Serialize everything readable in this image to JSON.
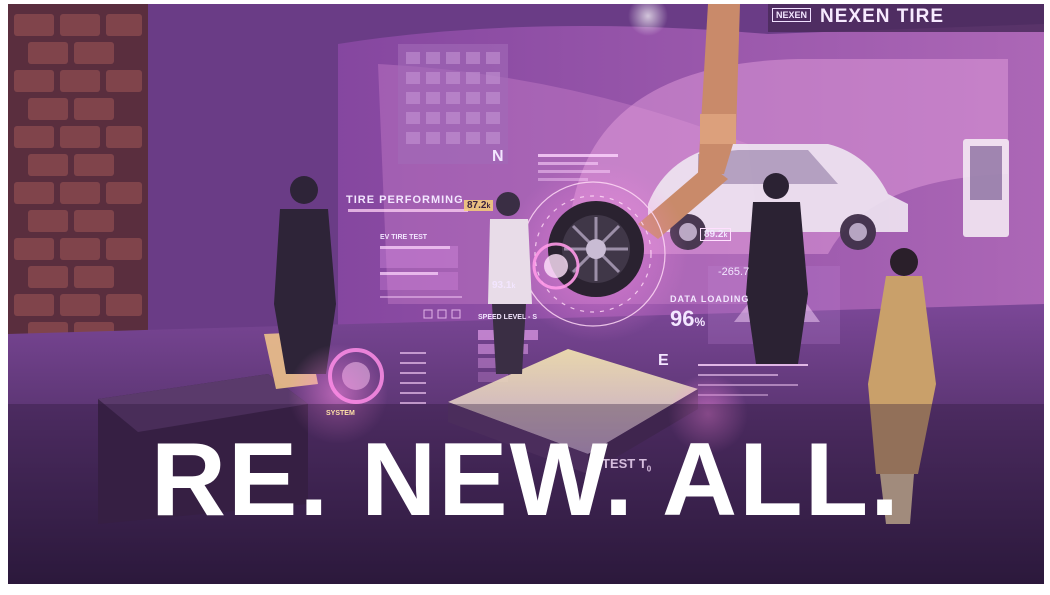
{
  "brand": {
    "logo_small": "NEXEN",
    "logo_text": "NEXEN TIRE"
  },
  "hud": {
    "tire_performing": "TIRE PERFORMING",
    "ev_tire_test": "EV TIRE TEST",
    "reading_1": "87.2",
    "reading_1_unit": "k",
    "reading_2": "89.2",
    "reading_2_unit": "k",
    "reading_3": "93.1",
    "reading_3_unit": "k",
    "letter_n": "N",
    "letter_e": "E",
    "speed_level": "SPEED LEVEL - S",
    "data_loading": "DATA LOADING",
    "data_loading_value": "96",
    "data_loading_unit": "%",
    "coordinate": "-265.7",
    "test_label": "TEST T",
    "test_sub": "0",
    "system_label": "SYSTEM"
  },
  "headline": "RE. NEW. ALL."
}
